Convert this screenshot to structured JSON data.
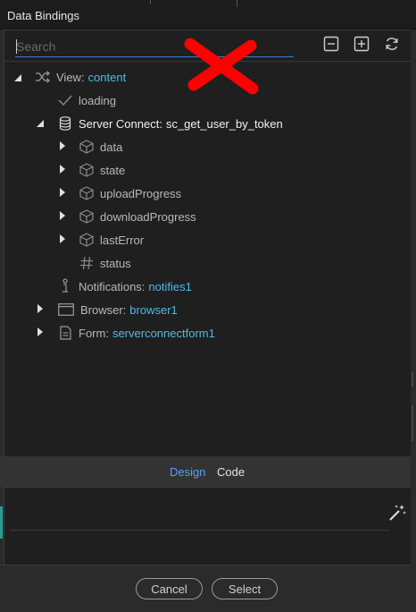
{
  "window": {
    "title": "Data Bindings"
  },
  "search": {
    "placeholder": "Search",
    "value": ""
  },
  "toolbar": {
    "collapse_icon": "minus-square-icon",
    "expand_icon": "plus-square-icon",
    "refresh_icon": "refresh-icon"
  },
  "tree": {
    "view": {
      "label": "View:",
      "value": "content"
    },
    "loading": {
      "label": "loading"
    },
    "server_connect": {
      "label": "Server Connect:",
      "value": "sc_get_user_by_token"
    },
    "children": [
      {
        "label": "data"
      },
      {
        "label": "state"
      },
      {
        "label": "uploadProgress"
      },
      {
        "label": "downloadProgress"
      },
      {
        "label": "lastError"
      },
      {
        "label": "status"
      }
    ],
    "notifications": {
      "label": "Notifications:",
      "value": "notifies1"
    },
    "browser": {
      "label": "Browser:",
      "value": "browser1"
    },
    "form": {
      "label": "Form:",
      "value": "serverconnectform1"
    }
  },
  "tabs": {
    "design": "Design",
    "code": "Code"
  },
  "footer": {
    "cancel": "Cancel",
    "select": "Select"
  },
  "colors": {
    "accent": "#4fb9e8",
    "tab_active": "#4fa3ff",
    "annotation": "#ff0000"
  }
}
